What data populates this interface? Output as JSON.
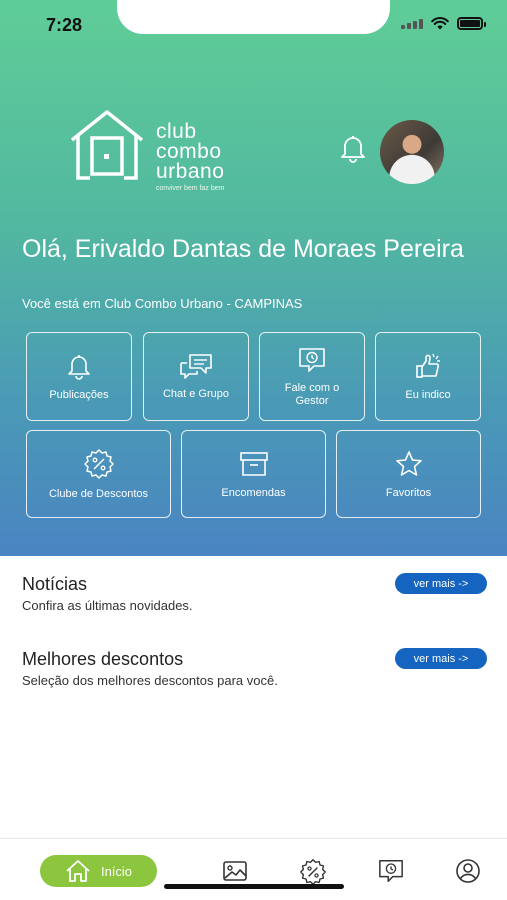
{
  "status_bar": {
    "time": "7:28"
  },
  "logo": {
    "line1": "club",
    "line2": "combo",
    "line3": "urbano",
    "tagline": "conviver bem faz bem"
  },
  "header": {
    "greeting": "Olá, Erivaldo Dantas de Moraes Pereira",
    "location": "Você está em Club Combo Urbano - CAMPINAS"
  },
  "menu": [
    {
      "label": "Publicações",
      "icon": "bell-icon"
    },
    {
      "label": "Chat e Grupo",
      "icon": "chat-icon"
    },
    {
      "label": "Fale com o Gestor",
      "icon": "clock-message-icon"
    },
    {
      "label": "Eu indico",
      "icon": "thumbs-up-icon"
    },
    {
      "label": "Clube de Descontos",
      "icon": "discount-badge-icon"
    },
    {
      "label": "Encomendas",
      "icon": "package-box-icon"
    },
    {
      "label": "Favoritos",
      "icon": "star-icon"
    }
  ],
  "sections": [
    {
      "title": "Notícias",
      "subtitle": "Confira as últimas novidades.",
      "button": "ver mais ->"
    },
    {
      "title": "Melhores descontos",
      "subtitle": "Seleção dos melhores descontos para você.",
      "button": "ver mais ->"
    }
  ],
  "tabbar": {
    "home_label": "Início",
    "active_color": "#8cc63f",
    "tabs": [
      "home-icon",
      "gallery-icon",
      "discount-badge-icon",
      "message-clock-icon",
      "profile-icon"
    ]
  },
  "colors": {
    "hero_top": "#5fcd97",
    "hero_bottom": "#4a84c2",
    "pill": "#1564c0"
  }
}
